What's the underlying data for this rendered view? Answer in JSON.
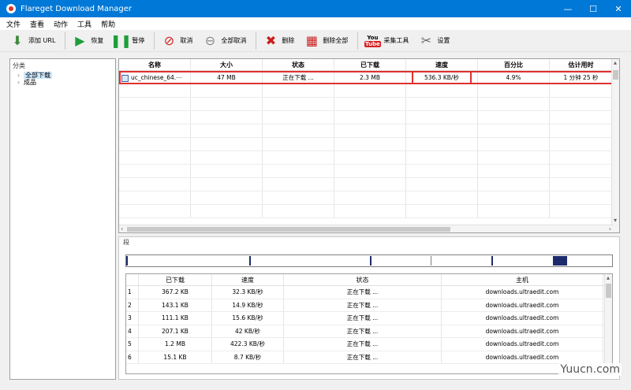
{
  "window": {
    "title": "Flareget Download Manager",
    "controls": {
      "minimize": "—",
      "maximize": "☐",
      "close": "✕"
    }
  },
  "menu": {
    "items": [
      "文件",
      "查看",
      "动作",
      "工具",
      "帮助"
    ]
  },
  "toolbar": {
    "add_url": "添加 URL",
    "resume": "恢复",
    "pause": "暂停",
    "cancel": "取消",
    "cancel_all": "全部取消",
    "delete": "删除",
    "delete_all": "删除全部",
    "grabber_logo_top": "You",
    "grabber_logo_bottom": "Tube",
    "grabber": "采集工具",
    "settings": "设置"
  },
  "categories": {
    "header": "分类",
    "items": [
      {
        "label": "全部下载",
        "selected": true
      },
      {
        "label": "成品",
        "selected": false
      }
    ]
  },
  "downloads": {
    "columns": [
      "名称",
      "大小",
      "状态",
      "已下载",
      "速度",
      "百分比",
      "估计用时"
    ],
    "rows": [
      {
        "name": "uc_chinese_64.⋯",
        "size": "47 MB",
        "status": "正在下载 ...",
        "downloaded": "2.3 MB",
        "speed": "536.3 KB/秒",
        "percent": "4.9%",
        "eta": "1 分钟 25 秒"
      }
    ]
  },
  "segments": {
    "tab_label": "段",
    "columns": [
      "",
      "已下载",
      "速度",
      "状态",
      "主机"
    ],
    "rows": [
      {
        "num": "1",
        "downloaded": "367.2 KB",
        "speed": "32.3 KB/秒",
        "status": "正在下载 ...",
        "host": "downloads.ultraedit.com"
      },
      {
        "num": "2",
        "downloaded": "143.1 KB",
        "speed": "14.9 KB/秒",
        "status": "正在下载 ...",
        "host": "downloads.ultraedit.com"
      },
      {
        "num": "3",
        "downloaded": "111.1 KB",
        "speed": "15.6 KB/秒",
        "status": "正在下载 ...",
        "host": "downloads.ultraedit.com"
      },
      {
        "num": "4",
        "downloaded": "207.1 KB",
        "speed": "42 KB/秒",
        "status": "正在下载 ...",
        "host": "downloads.ultraedit.com"
      },
      {
        "num": "5",
        "downloaded": "1.2 MB",
        "speed": "422.3 KB/秒",
        "status": "正在下载 ...",
        "host": "downloads.ultraedit.com"
      },
      {
        "num": "6",
        "downloaded": "15.1 KB",
        "speed": "8.7 KB/秒",
        "status": "正在下载 ...",
        "host": "downloads.ultraedit.com"
      }
    ]
  },
  "watermark": "Yuucn.com",
  "colors": {
    "titlebar": "#0078d7",
    "highlight": "#e03030",
    "segment": "#1c2b6b"
  }
}
